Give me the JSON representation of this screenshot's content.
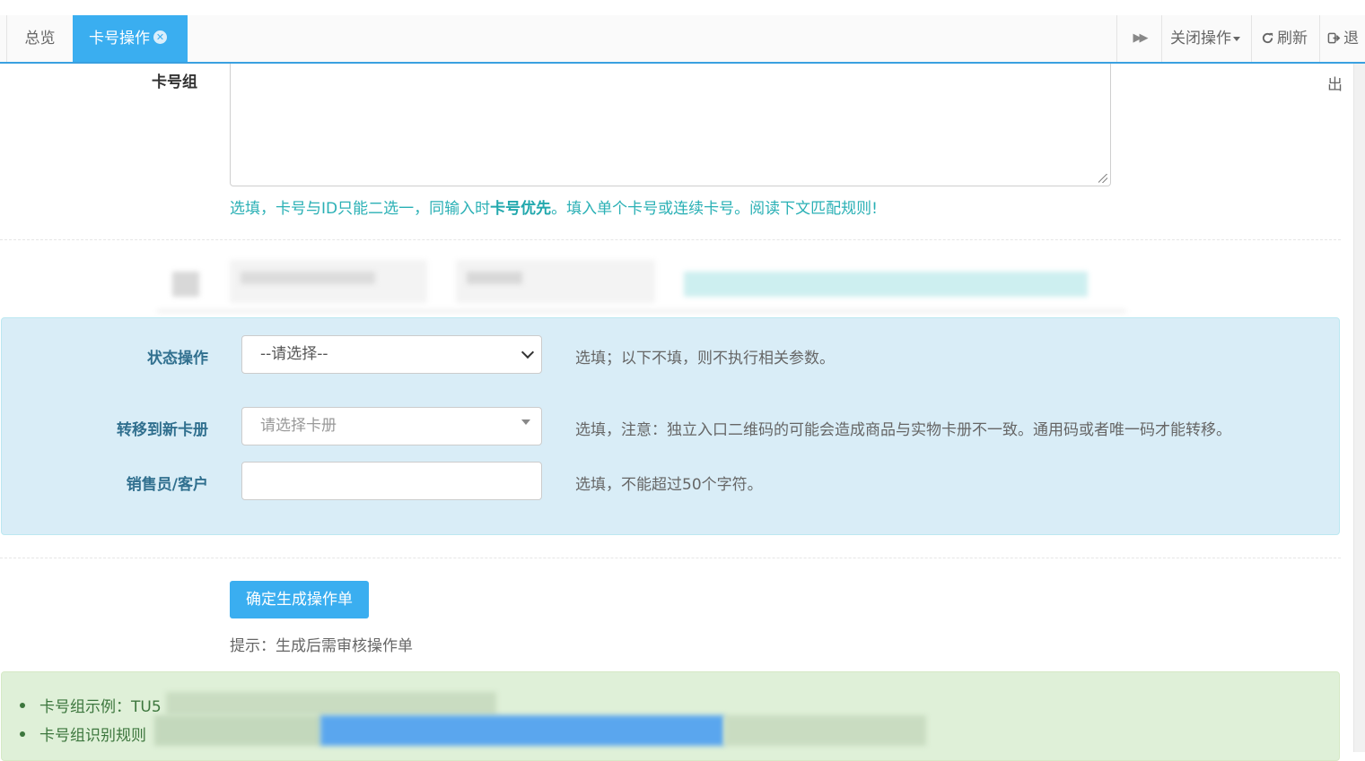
{
  "tabs": {
    "home_label": "总览",
    "active_label": "卡号操作",
    "close_glyph": "✕"
  },
  "toolbar": {
    "forward_icon": "▶▶",
    "close_ops_label": "关闭操作",
    "refresh_label": "刷新",
    "exit_label": "退出"
  },
  "card_group": {
    "label": "卡号组",
    "value": "",
    "hint_before": "选填，卡号与ID只能二选一，同输入时",
    "hint_bold": "卡号优先",
    "hint_after": "。填入单个卡号或连续卡号。阅读下文匹配规则!"
  },
  "status_op": {
    "label": "状态操作",
    "selected": "--请选择--",
    "help": "选填；以下不填，则不执行相关参数。"
  },
  "transfer": {
    "label": "转移到新卡册",
    "placeholder": "请选择卡册",
    "help": "选填，注意：独立入口二维码的可能会造成商品与实物卡册不一致。通用码或者唯一码才能转移。"
  },
  "sales": {
    "label": "销售员/客户",
    "value": "",
    "help": "选填，不能超过50个字符。"
  },
  "submit": {
    "label": "确定生成操作单",
    "tip": "提示：生成后需审核操作单"
  },
  "rules": {
    "item1": "卡号组示例：TU5",
    "item2": "卡号组识别规则"
  },
  "colors": {
    "accent": "#3aaef0",
    "hint_teal": "#2ab0b5",
    "panel_blue": "#d9edf7",
    "panel_green": "#dff0d8"
  }
}
